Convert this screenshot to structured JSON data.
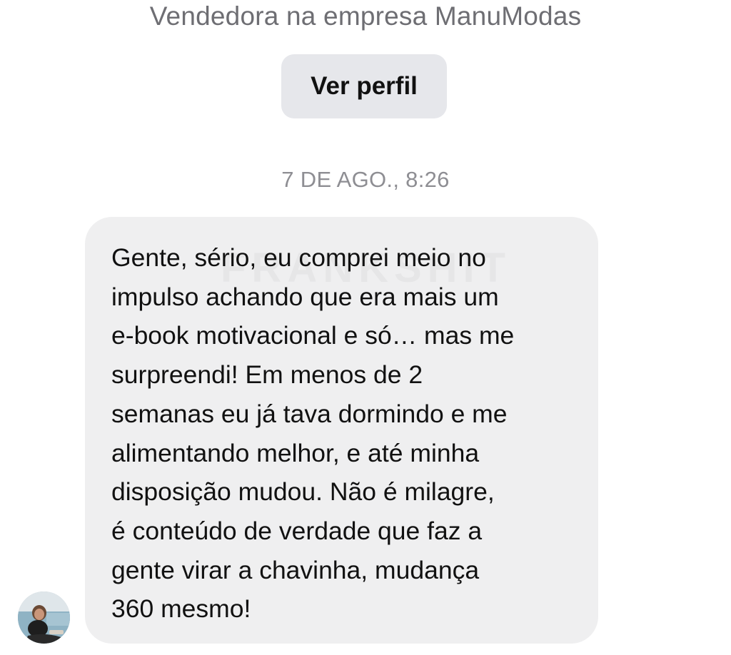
{
  "header": {
    "subtitle": "Vendedora na empresa ManuModas",
    "profile_button_label": "Ver perfil"
  },
  "thread": {
    "timestamp": "7 DE AGO., 8:26",
    "messages": [
      {
        "sender_avatar": "user-avatar",
        "watermark": "FRANKSHIT",
        "lines": [
          "Gente, sério, eu comprei meio no",
          "impulso achando que era mais um",
          "e-book motivacional e só… mas me",
          "surpreendi! Em menos de 2",
          "semanas eu já tava dormindo e me",
          "alimentando melhor, e até minha",
          "disposição mudou. Não é milagre,",
          "é conteúdo de verdade que faz a",
          "gente virar a chavinha, mudança",
          "360 mesmo!"
        ]
      }
    ]
  },
  "colors": {
    "background": "#ffffff",
    "bubble": "#efeff0",
    "button": "#e6e7eb",
    "muted_text": "#6e6e73",
    "timestamp_text": "#8e8e93",
    "message_text": "#111111"
  }
}
